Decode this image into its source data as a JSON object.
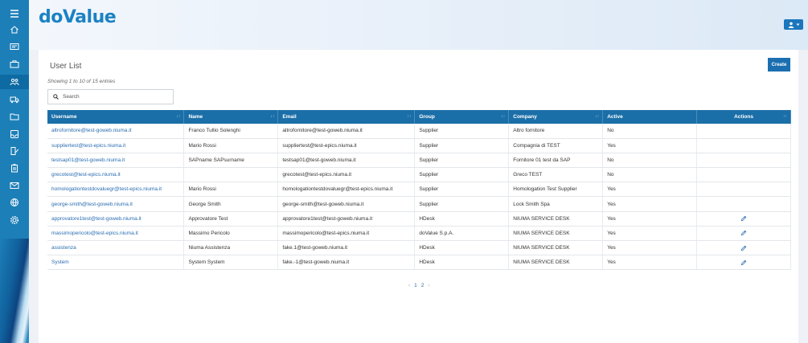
{
  "app": {
    "logo": "doValue"
  },
  "sidebar": {
    "items": [
      {
        "icon": "menu-icon"
      },
      {
        "icon": "home-icon"
      },
      {
        "icon": "id-card-icon"
      },
      {
        "icon": "briefcase-icon"
      },
      {
        "icon": "users-icon",
        "active": true
      },
      {
        "icon": "truck-icon"
      },
      {
        "icon": "folder-icon"
      },
      {
        "icon": "inbox-icon"
      },
      {
        "icon": "edit-document-icon"
      },
      {
        "icon": "clipboard-icon"
      },
      {
        "icon": "mail-icon"
      },
      {
        "icon": "globe-icon"
      },
      {
        "icon": "gear-icon"
      }
    ]
  },
  "page": {
    "title": "User List",
    "entries_info": "Showing 1 to 10 of 15 entries",
    "create_label": "Create",
    "search_placeholder": "Search"
  },
  "table": {
    "headers": [
      "Username",
      "Name",
      "Email",
      "Group",
      "Company",
      "Active",
      "Actions"
    ],
    "rows": [
      {
        "username": "altrofornitore@test-goweb.niuma.it",
        "name": "Franco Tullio Solenghi",
        "email": "altrofornitore@test-goweb.niuma.it",
        "group": "Supplier",
        "company": "Altro fornitore",
        "active": "No",
        "editable": false
      },
      {
        "username": "suppliertest@test-epics.niuma.it",
        "name": "Mario Rossi",
        "email": "suppliertest@test-epics.niuma.it",
        "group": "Supplier",
        "company": "Compagnia di TEST",
        "active": "Yes",
        "editable": false
      },
      {
        "username": "testsap01@test-goweb.niuma.it",
        "name": "SAPname SAPsurname",
        "email": "testsap01@test-goweb.niuma.it",
        "group": "Supplier",
        "company": "Fornitore 01 test da SAP",
        "active": "No",
        "editable": false
      },
      {
        "username": "grecotest@test-epics.niuma.it",
        "name": "",
        "email": "grecotest@test-epics.niuma.it",
        "group": "Supplier",
        "company": "Greco TEST",
        "active": "No",
        "editable": false
      },
      {
        "username": "homologationtestdovaluegr@test-epics.niuma.it",
        "name": "Mario Rossi",
        "email": "homologationtestdovaluegr@test-epics.niuma.it",
        "group": "Supplier",
        "company": "Homologation Test Supplier",
        "active": "Yes",
        "editable": false
      },
      {
        "username": "george-smith@test-goweb.niuma.it",
        "name": "George Smith",
        "email": "george-smith@test-goweb.niuma.it",
        "group": "Supplier",
        "company": "Lock Smith Spa",
        "active": "Yes",
        "editable": false
      },
      {
        "username": "approvatore1test@test-goweb.niuma.it",
        "name": "Approvatore Test",
        "email": "approvatore1test@test-goweb.niuma.it",
        "group": "HDesk",
        "company": "NIUMA SERVICE DESK",
        "active": "Yes",
        "editable": true
      },
      {
        "username": "massimopericolo@test-epics.niuma.it",
        "name": "Massimo Pericolo",
        "email": "massimopericolo@test-epics.niuma.it",
        "group": "doValue S.p.A.",
        "company": "NIUMA SERVICE DESK",
        "active": "Yes",
        "editable": true
      },
      {
        "username": "assistenza",
        "name": "Niuma Assistenza",
        "email": "fake.1@test-goweb.niuma.it",
        "group": "HDesk",
        "company": "NIUMA SERVICE DESK",
        "active": "Yes",
        "editable": true
      },
      {
        "username": "System",
        "name": "System System",
        "email": "fake.-1@test-goweb.niuma.it",
        "group": "HDesk",
        "company": "NIUMA SERVICE DESK",
        "active": "Yes",
        "editable": true
      }
    ]
  },
  "pagination": {
    "prev": "‹",
    "pages": [
      "1",
      "2"
    ],
    "next": "›"
  }
}
